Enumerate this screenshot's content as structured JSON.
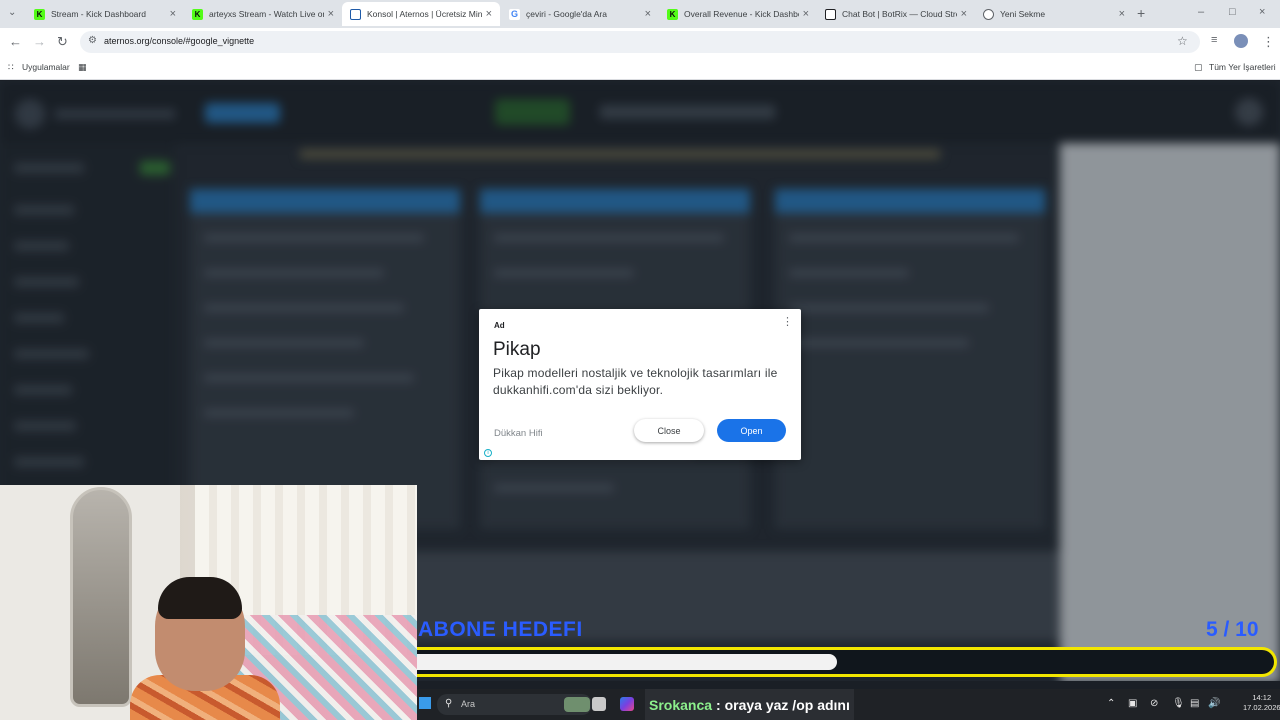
{
  "browser": {
    "tabs": [
      {
        "title": "Stream - Kick Dashboard",
        "favicon": "kick-icon",
        "active": false
      },
      {
        "title": "arteyxs Stream - Watch Live on",
        "favicon": "kick-icon",
        "active": false
      },
      {
        "title": "Konsol | Aternos | Ücretsiz Min",
        "favicon": "aternos-icon",
        "active": true
      },
      {
        "title": "çeviri - Google'da Ara",
        "favicon": "google-icon",
        "active": false
      },
      {
        "title": "Overall Revenue - Kick Dashboar",
        "favicon": "kick-icon",
        "active": false
      },
      {
        "title": "Chat Bot | BotRix — Cloud Stre",
        "favicon": "botrix-icon",
        "active": false
      },
      {
        "title": "Yeni Sekme",
        "favicon": "globe-icon",
        "active": false
      }
    ],
    "url": "aternos.org/console/#google_vignette",
    "bookmarks": {
      "apps_label": "Uygulamalar",
      "all_bookmarks_label": "Tüm Yer İşaretleri"
    }
  },
  "ad": {
    "label": "Ad",
    "title": "Pikap",
    "body": "Pikap modelleri nostaljik ve teknolojik tasarımları ile dukkanhifi.com'da sizi bekliyor.",
    "advertiser": "Dükkan Hifi",
    "close_label": "Close",
    "open_label": "Open"
  },
  "overlay": {
    "goal_title": "ABONE HEDEFI",
    "goal_count": "5  / 10",
    "progress_fraction": 0.5
  },
  "taskbar": {
    "search_placeholder": "Ara",
    "chat_user": "Srokanca",
    "chat_message": ": oraya yaz /op adını",
    "time": "14:12",
    "date": "17.02.2026"
  },
  "colors": {
    "accent_blue": "#1a73e8",
    "goal_text": "#2a5cff",
    "goal_border": "#f2e600",
    "kick_green": "#53fc18"
  }
}
